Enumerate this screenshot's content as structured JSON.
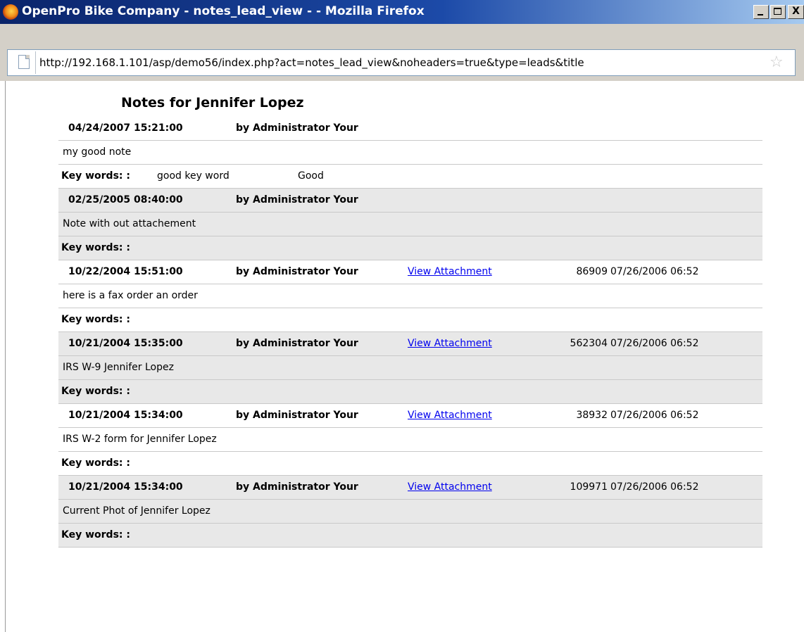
{
  "window": {
    "title": "OpenPro Bike Company - notes_lead_view - - Mozilla Firefox",
    "buttons": {
      "minimize": "_",
      "maximize": "□",
      "close": "X"
    }
  },
  "browser": {
    "url": "http://192.168.1.101/asp/demo56/index.php?act=notes_lead_view&noheaders=true&type=leads&title",
    "icons": [
      "firefox-icon",
      "page-icon",
      "star-icon"
    ]
  },
  "page": {
    "title": "Notes for Jennifer Lopez",
    "keywords_label": "Key words: :",
    "notes": [
      {
        "date": "04/24/2007 15:21:00",
        "author": "by Administrator Your",
        "attachment": "",
        "size": "",
        "stamp": "",
        "text": "my good note",
        "keywords": "good key word",
        "keywords_extra": "Good"
      },
      {
        "date": "02/25/2005 08:40:00",
        "author": "by Administrator Your",
        "attachment": "",
        "size": "",
        "stamp": "",
        "text": "Note with out attachement",
        "keywords": "",
        "keywords_extra": ""
      },
      {
        "date": "10/22/2004 15:51:00",
        "author": "by Administrator Your",
        "attachment": "View Attachment",
        "size": "86909",
        "stamp": "07/26/2006 06:52",
        "text": "here is a fax order an order",
        "keywords": "",
        "keywords_extra": ""
      },
      {
        "date": "10/21/2004 15:35:00",
        "author": "by Administrator Your",
        "attachment": "View Attachment",
        "size": "562304",
        "stamp": "07/26/2006 06:52",
        "text": "IRS W-9 Jennifer Lopez",
        "keywords": "",
        "keywords_extra": ""
      },
      {
        "date": "10/21/2004 15:34:00",
        "author": "by Administrator Your",
        "attachment": "View Attachment",
        "size": "38932",
        "stamp": "07/26/2006 06:52",
        "text": "IRS W-2 form for Jennifer Lopez",
        "keywords": "",
        "keywords_extra": ""
      },
      {
        "date": "10/21/2004 15:34:00",
        "author": "by Administrator Your",
        "attachment": "View Attachment",
        "size": "109971",
        "stamp": "07/26/2006 06:52",
        "text": "Current Phot of Jennifer Lopez",
        "keywords": "",
        "keywords_extra": ""
      }
    ]
  }
}
